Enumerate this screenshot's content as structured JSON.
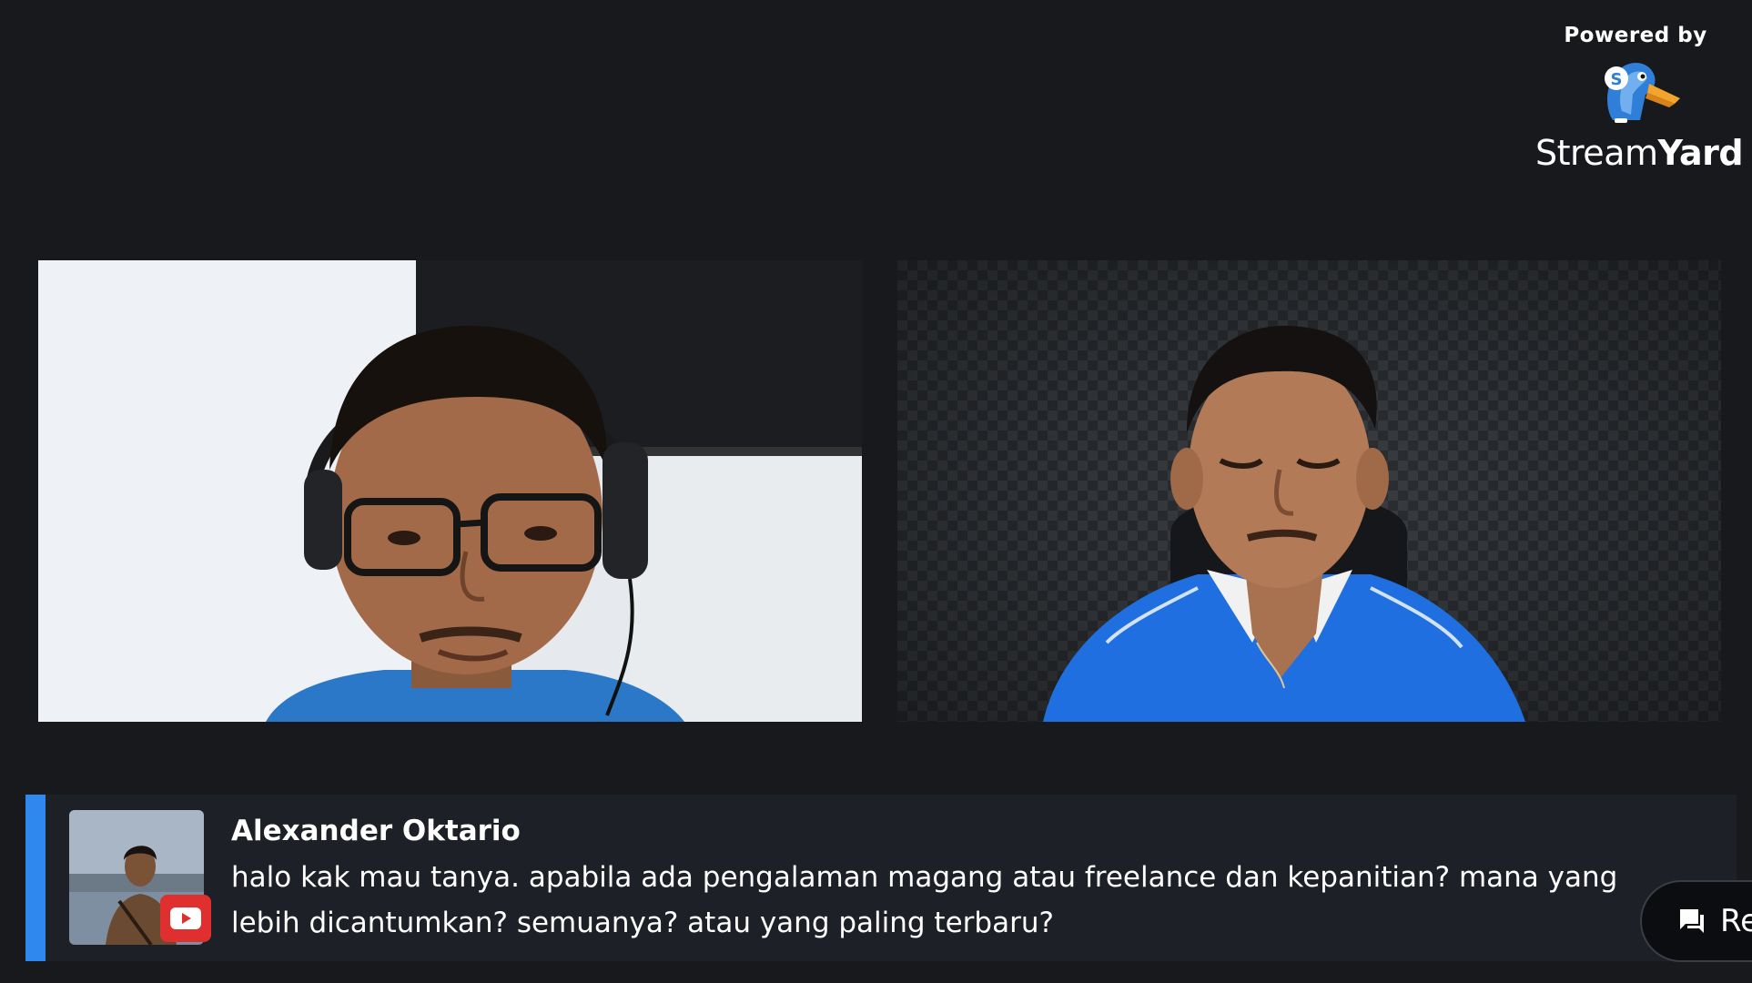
{
  "branding": {
    "powered_by": "Powered by",
    "wordmark_light": "Stream",
    "wordmark_bold": "Yard",
    "logo_icon": "streamyard-bird-icon"
  },
  "participants": [
    {
      "name": "participant-left",
      "shirt_color": "#2a78c7",
      "background": "white-wall"
    },
    {
      "name": "participant-right",
      "shirt_color": "#1f6fe0",
      "background": "acoustic-foam"
    }
  ],
  "chat": {
    "author": "Alexander Oktario",
    "message": "halo kak mau tanya. apabila ada pengalaman magang atau freelance dan kepanitian? mana yang lebih dicantumkan? semuanya? atau yang paling terbaru?",
    "platform_icon": "youtube-icon",
    "accent_color": "#2f88ee"
  },
  "reply_button": {
    "label": "Re",
    "icon": "chat-bubble-icon"
  }
}
